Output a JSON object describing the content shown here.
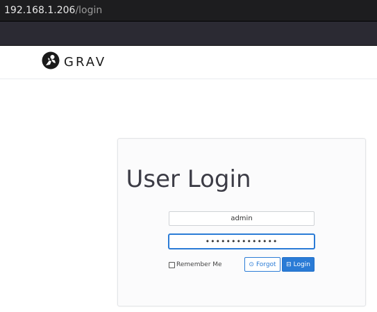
{
  "browser": {
    "url_host": "192.168.1.206",
    "url_path": "/login"
  },
  "brand": {
    "name": "GRAV",
    "logo_icon": "grav-astronaut-logo"
  },
  "login": {
    "title": "User Login",
    "username_value": "admin",
    "password_mask": "••••••••••••••",
    "remember_label": "Remember Me",
    "forgot_label": "Forgot",
    "forgot_icon": "clock-icon",
    "login_label": "Login",
    "login_icon": "sign-in-icon"
  },
  "colors": {
    "accent": "#2a7bd6",
    "title_text": "#3c3c46"
  }
}
